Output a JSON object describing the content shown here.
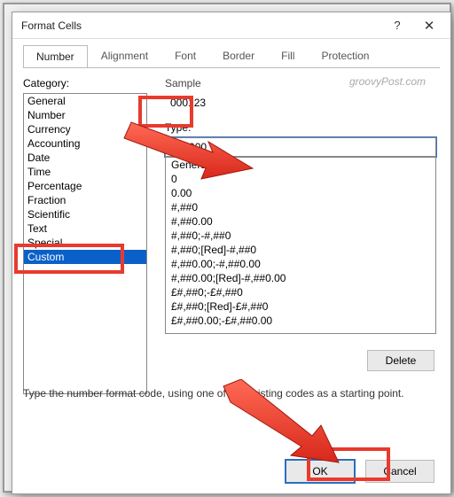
{
  "title": "Format Cells",
  "tabs": {
    "number": "Number",
    "alignment": "Alignment",
    "font": "Font",
    "border": "Border",
    "fill": "Fill",
    "protection": "Protection"
  },
  "category_label": "Category:",
  "categories": {
    "c0": "General",
    "c1": "Number",
    "c2": "Currency",
    "c3": "Accounting",
    "c4": "Date",
    "c5": "Time",
    "c6": "Percentage",
    "c7": "Fraction",
    "c8": "Scientific",
    "c9": "Text",
    "c10": "Special",
    "c11": "Custom"
  },
  "sample_label": "Sample",
  "sample_value": "000123",
  "type_label": "Type:",
  "type_value": "000000",
  "formats": {
    "f0": "General",
    "f1": "0",
    "f2": "0.00",
    "f3": "#,##0",
    "f4": "#,##0.00",
    "f5": "#,##0;-#,##0",
    "f6": "#,##0;[Red]-#,##0",
    "f7": "#,##0.00;-#,##0.00",
    "f8": "#,##0.00;[Red]-#,##0.00",
    "f9": "£#,##0;-£#,##0",
    "f10": "£#,##0;[Red]-£#,##0",
    "f11": "£#,##0.00;-£#,##0.00"
  },
  "delete_label": "Delete",
  "hint": "Type the number format code, using one of the existing codes as a starting point.",
  "ok_label": "OK",
  "cancel_label": "Cancel",
  "watermark": "groovyPost.com"
}
